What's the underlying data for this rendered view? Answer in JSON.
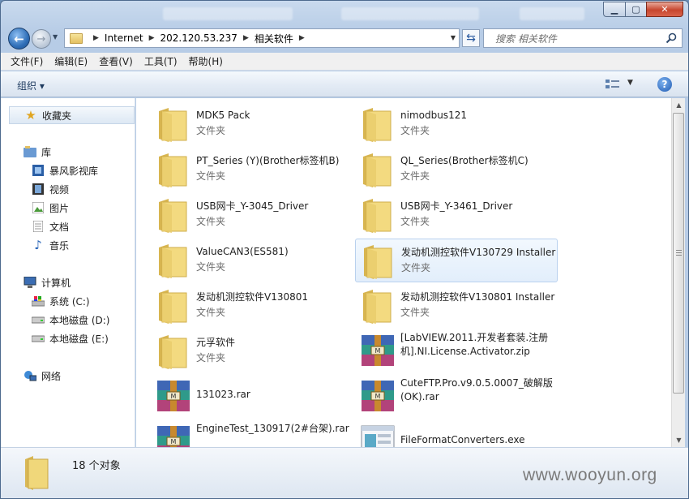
{
  "address": {
    "crumbs": [
      "Internet",
      "202.120.53.237",
      "相关软件"
    ]
  },
  "search": {
    "placeholder": "搜索 相关软件"
  },
  "menu": [
    {
      "label": "文件(F)"
    },
    {
      "label": "编辑(E)"
    },
    {
      "label": "查看(V)"
    },
    {
      "label": "工具(T)"
    },
    {
      "label": "帮助(H)"
    }
  ],
  "toolbar": {
    "organize_label": "组织 ▾"
  },
  "sidebar": {
    "favorites": "收藏夹",
    "libraries": "库",
    "library_items": [
      "暴风影视库",
      "视频",
      "图片",
      "文档",
      "音乐"
    ],
    "computer": "计算机",
    "drives": [
      "系统 (C:)",
      "本地磁盘 (D:)",
      "本地磁盘 (E:)"
    ],
    "network": "网络"
  },
  "items": [
    {
      "name": "MDK5 Pack",
      "type": "文件夹",
      "icon": "folder-icon"
    },
    {
      "name": "nimodbus121",
      "type": "文件夹",
      "icon": "folder-icon"
    },
    {
      "name": "PT_Series (Y)(Brother标签机B)",
      "type": "文件夹",
      "icon": "folder-icon"
    },
    {
      "name": "QL_Series(Brother标签机C)",
      "type": "文件夹",
      "icon": "folder-icon"
    },
    {
      "name": "USB网卡_Y-3045_Driver",
      "type": "文件夹",
      "icon": "folder-icon"
    },
    {
      "name": "USB网卡_Y-3461_Driver",
      "type": "文件夹",
      "icon": "folder-icon"
    },
    {
      "name": "ValueCAN3(ES581)",
      "type": "文件夹",
      "icon": "folder-icon"
    },
    {
      "name": "发动机测控软件V130729 Installer",
      "type": "文件夹",
      "icon": "folder-icon",
      "selected": true
    },
    {
      "name": "发动机测控软件V130801",
      "type": "文件夹",
      "icon": "folder-icon"
    },
    {
      "name": "发动机测控软件V130801 Installer",
      "type": "文件夹",
      "icon": "folder-icon"
    },
    {
      "name": "元孚软件",
      "type": "文件夹",
      "icon": "folder-icon"
    },
    {
      "name": "[LabVIEW.2011.开发者套装.注册机].NI.License.Activator.zip",
      "type": "",
      "icon": "winrar-icon"
    },
    {
      "name": "131023.rar",
      "type": "",
      "icon": "winrar-icon"
    },
    {
      "name": "CuteFTP.Pro.v9.0.5.0007_破解版(OK).rar",
      "type": "",
      "icon": "winrar-icon"
    },
    {
      "name": "EngineTest_130917(2#台架).rar",
      "type": "",
      "icon": "winrar-icon"
    },
    {
      "name": "FileFormatConverters.exe",
      "type": "",
      "icon": "exe-icon"
    }
  ],
  "status": {
    "count": "18 个对象"
  },
  "watermark": "www.wooyun.org",
  "colors": {
    "folder": "#f0d77a",
    "selection": "#e2eefb",
    "accent": "#2f6fb8"
  }
}
